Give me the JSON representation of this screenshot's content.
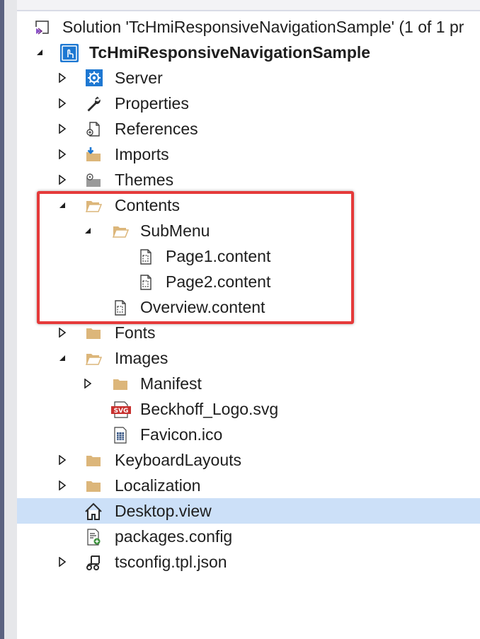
{
  "solution": {
    "label": "Solution 'TcHmiResponsiveNavigationSample' (1 of 1 pr",
    "icon": "solution-icon"
  },
  "project": {
    "label": "TcHmiResponsiveNavigationSample",
    "icon": "hmi-project-icon",
    "expanded": true
  },
  "items": {
    "server": {
      "label": "Server",
      "icon": "server-gear-icon",
      "expanded": false
    },
    "properties": {
      "label": "Properties",
      "icon": "wrench-icon",
      "expanded": false
    },
    "references": {
      "label": "References",
      "icon": "references-icon",
      "expanded": false
    },
    "imports": {
      "label": "Imports",
      "icon": "imports-folder-icon",
      "expanded": false
    },
    "themes": {
      "label": "Themes",
      "icon": "themes-folder-icon",
      "expanded": false
    },
    "contents": {
      "label": "Contents",
      "icon": "folder-open-icon",
      "expanded": true
    },
    "submenu": {
      "label": "SubMenu",
      "icon": "folder-open-icon",
      "expanded": true
    },
    "page1": {
      "label": "Page1.content",
      "icon": "content-file-icon"
    },
    "page2": {
      "label": "Page2.content",
      "icon": "content-file-icon"
    },
    "overview": {
      "label": "Overview.content",
      "icon": "content-file-icon"
    },
    "fonts": {
      "label": "Fonts",
      "icon": "folder-icon",
      "expanded": false
    },
    "images": {
      "label": "Images",
      "icon": "folder-open-icon",
      "expanded": true
    },
    "manifest": {
      "label": "Manifest",
      "icon": "folder-icon",
      "expanded": false
    },
    "beckhoff_logo": {
      "label": "Beckhoff_Logo.svg",
      "icon": "svg-file-icon"
    },
    "favicon": {
      "label": "Favicon.ico",
      "icon": "ico-file-icon"
    },
    "keyboard_layouts": {
      "label": "KeyboardLayouts",
      "icon": "folder-icon",
      "expanded": false
    },
    "localization": {
      "label": "Localization",
      "icon": "folder-icon",
      "expanded": false
    },
    "desktop_view": {
      "label": "Desktop.view",
      "icon": "home-icon",
      "selected": true
    },
    "packages_config": {
      "label": "packages.config",
      "icon": "config-file-icon"
    },
    "tsconfig": {
      "label": "tsconfig.tpl.json",
      "icon": "json-file-icon",
      "expanded": false
    }
  },
  "colors": {
    "selection": "#cce0f8",
    "highlight_border": "#e53a3a",
    "folder": "#dcb67a",
    "accent_blue": "#1e78d2"
  }
}
